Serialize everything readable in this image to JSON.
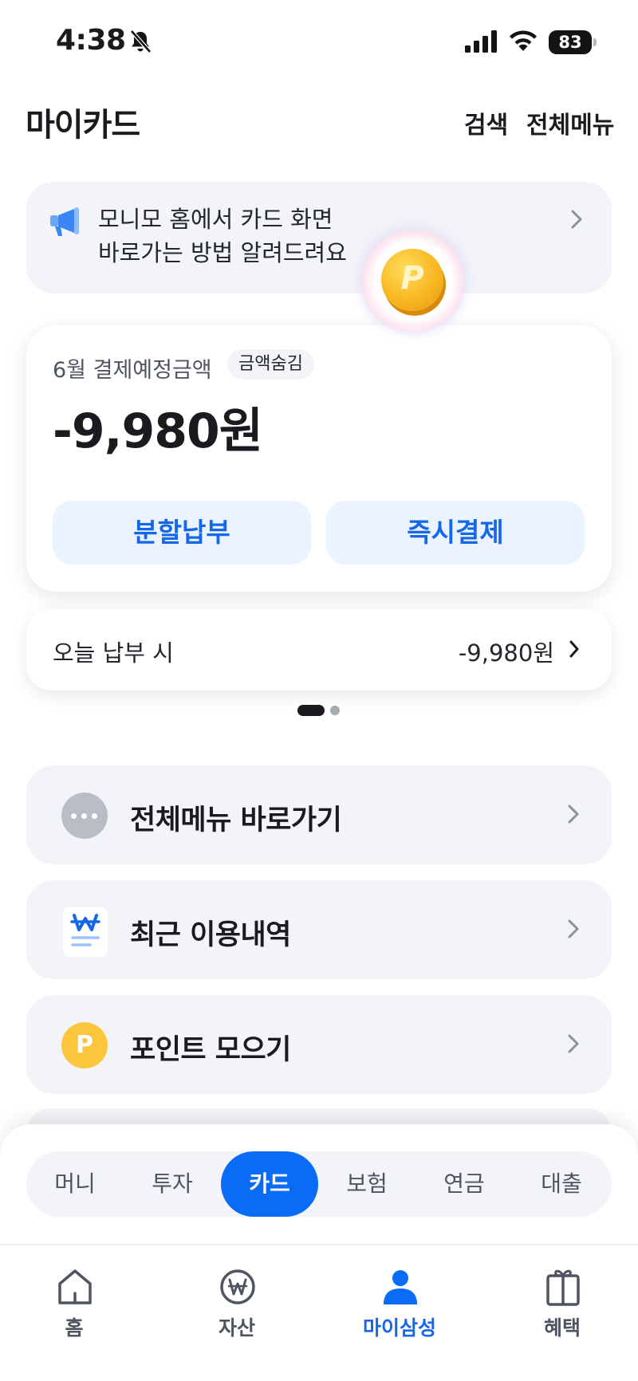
{
  "status_bar": {
    "time": "4:38",
    "battery": "83"
  },
  "header": {
    "title": "마이카드",
    "search": "검색",
    "all_menu": "전체메뉴"
  },
  "notice": {
    "line1": "모니모 홈에서 카드 화면",
    "line2": "바로가는 방법 알려드려요"
  },
  "coin": {
    "letter": "P"
  },
  "payment_card": {
    "label": "6월 결제예정금액",
    "hide_badge": "금액숨김",
    "amount": "-9,980원",
    "split_button": "분할납부",
    "pay_now_button": "즉시결제"
  },
  "today": {
    "label": "오늘 납부 시",
    "amount": "-9,980원"
  },
  "pagination": {
    "current": 1,
    "total": 2
  },
  "menu": {
    "items": [
      {
        "label": "전체메뉴 바로가기",
        "icon": "more-dots-icon"
      },
      {
        "label": "최근 이용내역",
        "icon": "won-receipt-icon"
      },
      {
        "label": "포인트 모으기",
        "icon": "point-coin-icon",
        "icon_letter": "P"
      }
    ]
  },
  "categories": {
    "items": [
      "머니",
      "투자",
      "카드",
      "보험",
      "연금",
      "대출"
    ],
    "selected": "카드"
  },
  "bottom_nav": {
    "items": [
      {
        "label": "홈",
        "icon": "home-icon"
      },
      {
        "label": "자산",
        "icon": "won-circle-icon"
      },
      {
        "label": "마이삼성",
        "icon": "person-icon"
      },
      {
        "label": "혜택",
        "icon": "gift-icon"
      }
    ],
    "selected": "마이삼성"
  },
  "colors": {
    "accent": "#0a6cf6",
    "accent_text": "#1468e8",
    "card_bg": "#f2f4f7",
    "button_bg": "#eaf3ff",
    "point_yellow": "#fbc53c"
  }
}
